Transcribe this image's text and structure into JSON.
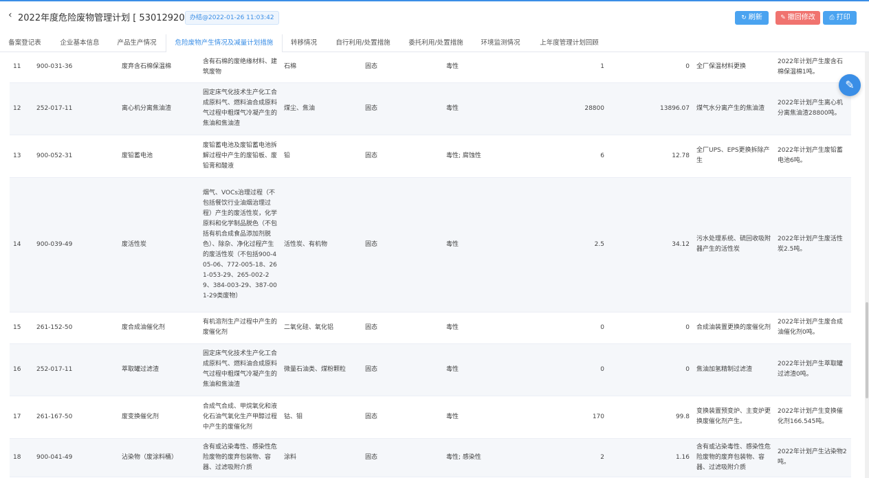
{
  "header": {
    "back_icon": "chevron-left-icon",
    "title": "2022年度危险废物管理计划 [ 53012920220035 ]",
    "time_badge": "办结@2022-01-26 11:03:42",
    "buttons": {
      "refresh": "刷新",
      "revoke": "撤回修改",
      "print": "打印"
    },
    "colors": {
      "primary": "#3a8ee6",
      "danger": "#f0736f"
    }
  },
  "tabs": [
    {
      "label": "备案登记表"
    },
    {
      "label": "企业基本信息"
    },
    {
      "label": "产品生产情况"
    },
    {
      "label": "危险废物产生情况及减量计划措施"
    },
    {
      "label": "转移情况"
    },
    {
      "label": "自行利用/处置措施"
    },
    {
      "label": "委托利用/处置措施"
    },
    {
      "label": "环境监测情况"
    },
    {
      "label": "上年度管理计划回顾"
    }
  ],
  "active_tab": 3,
  "rows": [
    {
      "no": "11",
      "code": "900-031-36",
      "name": "废弃含石棉保温棉",
      "source": "含有石棉的废绝缘材料、建筑废物",
      "component": "石棉",
      "form": "固态",
      "hazard": "毒性",
      "plan": "1",
      "actual": "0",
      "measure": "全厂保温材料更换",
      "note": "2022年计划产生废含石棉保温棉1吨。"
    },
    {
      "no": "12",
      "code": "252-017-11",
      "name": "离心机分离焦油渣",
      "source": "固定床气化技术生产化工合成原料气、燃料油合成原料气过程中粗煤气冷凝产生的焦油和焦油渣",
      "component": "煤尘、焦油",
      "form": "固态",
      "hazard": "毒性",
      "plan": "28800",
      "actual": "13896.07",
      "measure": "煤气水分离产生的焦油渣",
      "note": "2022年计划产生离心机分离焦油渣28800吨。"
    },
    {
      "no": "13",
      "code": "900-052-31",
      "name": "废铅蓄电池",
      "source": "废铅蓄电池及废铅蓄电池拆解过程中产生的废铅板、废铅膏和酸液",
      "component": "铅",
      "form": "固态",
      "hazard": "毒性; 腐蚀性",
      "plan": "6",
      "actual": "12.78",
      "measure": "全厂UPS、EPS更换拆除产生",
      "note": "2022年计划产生废铅蓄电池6吨。"
    },
    {
      "no": "14",
      "code": "900-039-49",
      "name": "废活性炭",
      "source": "烟气、VOCs治理过程（不包括餐饮行业油烟治理过程）产生的废活性炭，化学原料和化学制品脱色（不包括有机合成食品添加剂脱色）、除杂、净化过程产生的废活性炭（不包括900-405-06、772-005-18、261-053-29、265-002-29、384-003-29、387-001-29类废物）",
      "component": "活性炭、有机物",
      "form": "固态",
      "hazard": "毒性",
      "plan": "2.5",
      "actual": "34.12",
      "measure": "污水处理系统、硫回收吸附器产生的活性炭",
      "note": "2022年计划产生废活性炭2.5吨。"
    },
    {
      "no": "15",
      "code": "261-152-50",
      "name": "废合成油催化剂",
      "source": "有机溶剂生产过程中产生的废催化剂",
      "component": "二氧化硅、氧化铝",
      "form": "固态",
      "hazard": "毒性",
      "plan": "0",
      "actual": "0",
      "measure": "合成油装置更换的废催化剂",
      "note": "2022年计划产生废合成油催化剂0吨。"
    },
    {
      "no": "16",
      "code": "252-017-11",
      "name": "萃取罐过滤渣",
      "source": "固定床气化技术生产化工合成原料气、燃料油合成原料气过程中粗煤气冷凝产生的焦油和焦油渣",
      "component": "微量石油类、煤粉颗粒",
      "form": "固态",
      "hazard": "毒性",
      "plan": "0",
      "actual": "0",
      "measure": "焦油加氢精制过滤渣",
      "note": "2022年计划产生萃取罐过滤渣0吨。"
    },
    {
      "no": "17",
      "code": "261-167-50",
      "name": "废变换催化剂",
      "source": "合成气合成、甲烷氧化和液化石油气氧化生产甲醇过程中产生的废催化剂",
      "component": "钴、钼",
      "form": "固态",
      "hazard": "毒性",
      "plan": "170",
      "actual": "99.8",
      "measure": "变换装置预变炉、主变炉更换废催化剂产生。",
      "note": "2022年计划产生变换催化剂166.545吨。"
    },
    {
      "no": "18",
      "code": "900-041-49",
      "name": "沾染物（废涂料桶）",
      "source": "含有或沾染毒性、感染性危险废物的废弃包装物、容器、过滤吸附介质",
      "component": "涂料",
      "form": "固态",
      "hazard": "毒性; 感染性",
      "plan": "2",
      "actual": "1.16",
      "measure": "含有或沾染毒性、感染性危险废物的废弃包装物、容器、过滤吸附介质",
      "note": "2022年计划产生沾染物2吨。"
    }
  ],
  "fab_icon": "pencil-edit-icon"
}
